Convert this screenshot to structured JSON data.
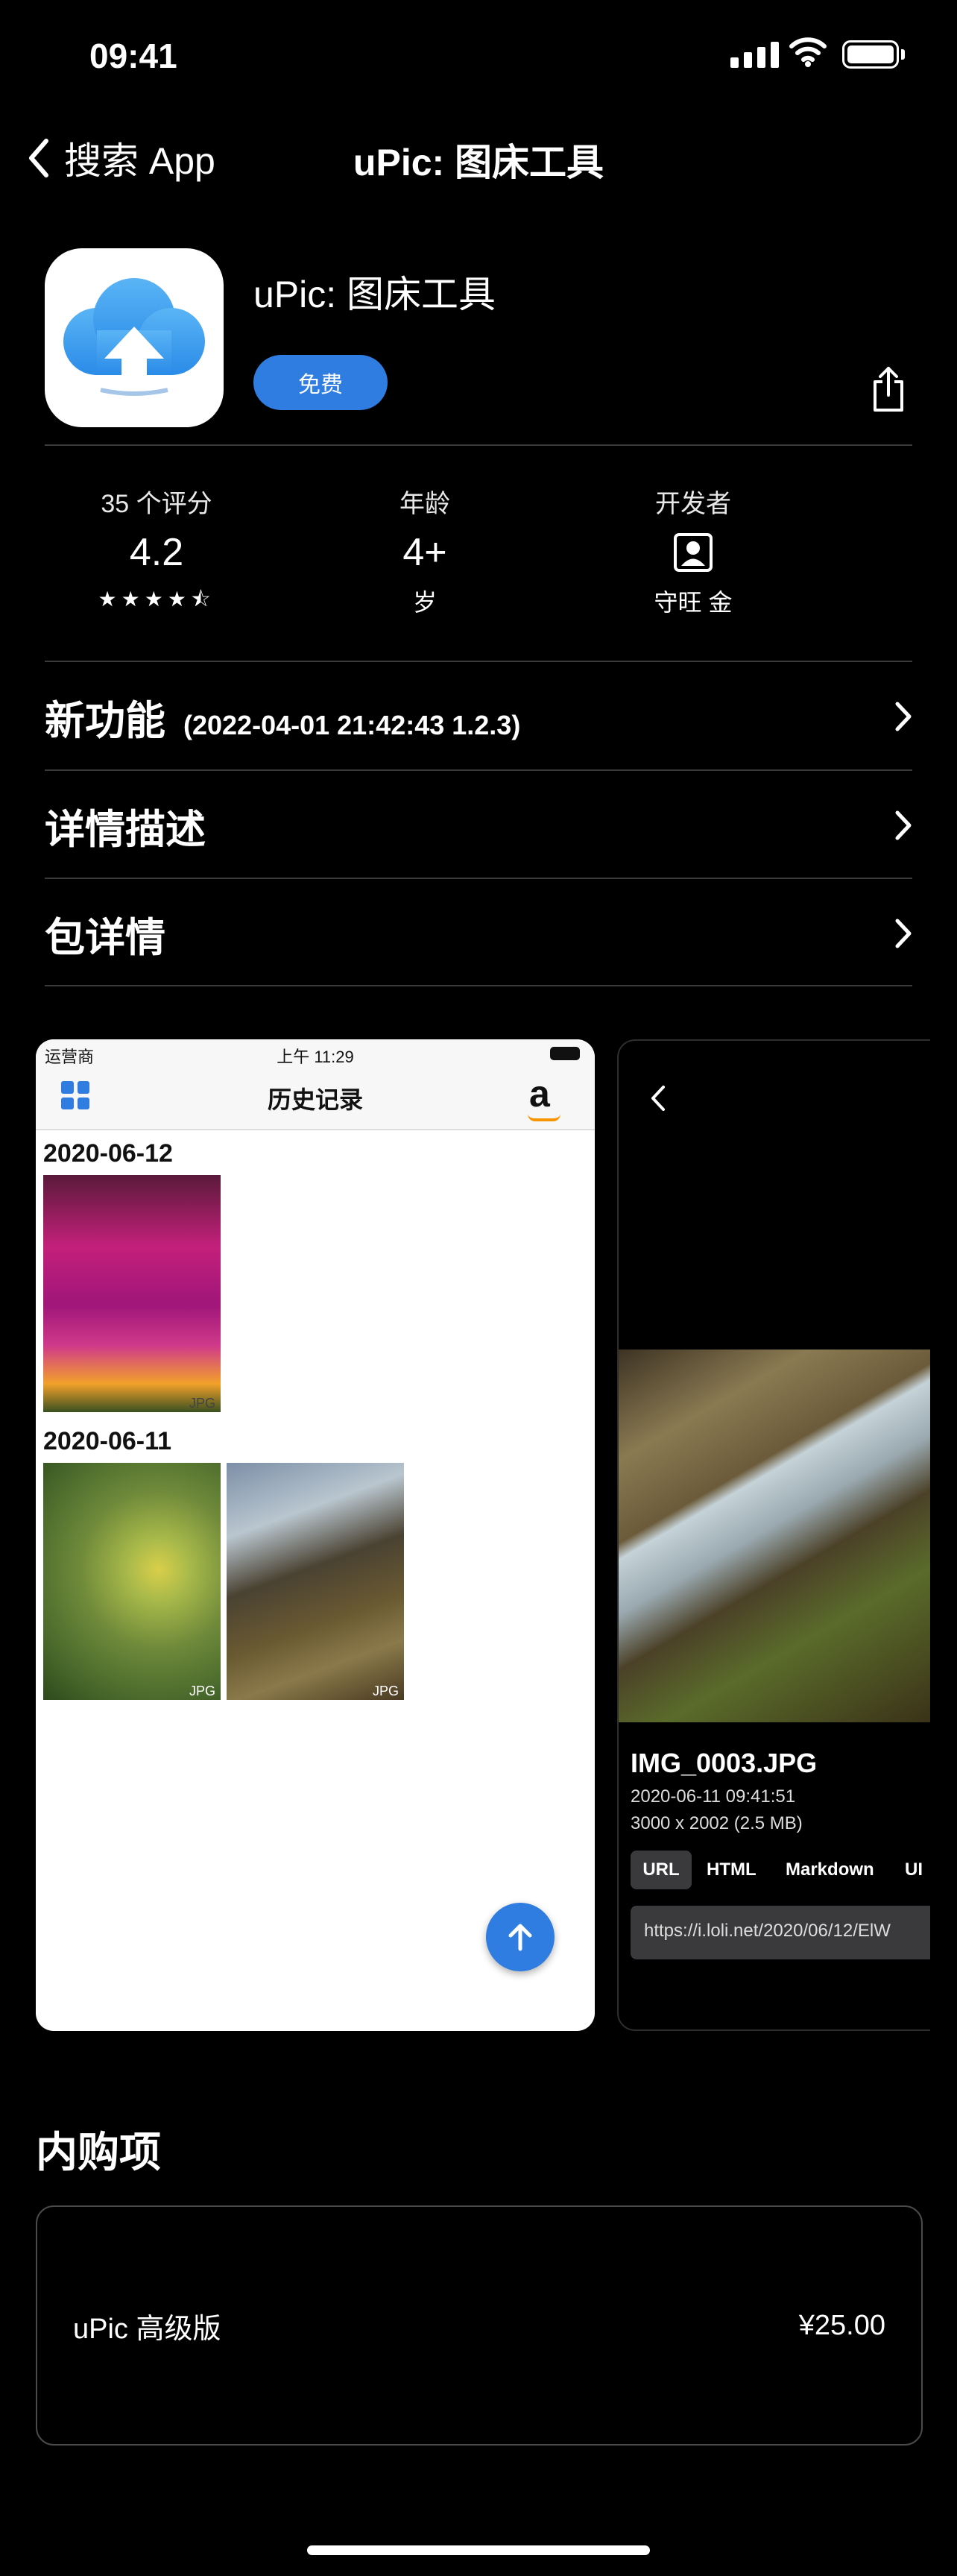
{
  "status_bar": {
    "time": "09:41"
  },
  "nav": {
    "back_label": "搜索 App",
    "title": "uPic: 图床工具"
  },
  "app": {
    "name": "uPic: 图床工具",
    "get_label": "免费"
  },
  "stats": {
    "ratings": {
      "label": "35 个评分",
      "value": "4.2",
      "stars": "★★★★⯪"
    },
    "age": {
      "label": "年龄",
      "value": "4+",
      "unit": "岁"
    },
    "developer": {
      "label": "开发者",
      "name": "守旺 金"
    }
  },
  "rows": {
    "whats_new": {
      "title": "新功能",
      "meta": "(2022-04-01 21:42:43  1.2.3)"
    },
    "description": {
      "title": "详情描述"
    },
    "package": {
      "title": "包详情"
    }
  },
  "screenshot1": {
    "carrier": "运营商",
    "time": "上午 11:29",
    "title": "历史记录",
    "amazon": "a",
    "groups": [
      {
        "date": "2020-06-12",
        "tags": [
          "JPG"
        ]
      },
      {
        "date": "2020-06-11",
        "tags": [
          "JPG",
          "JPG"
        ]
      }
    ]
  },
  "screenshot2": {
    "filename": "IMG_0003.JPG",
    "datetime": "2020-06-11 09:41:51",
    "size": "3000 x 2002 (2.5 MB)",
    "tabs": [
      "URL",
      "HTML",
      "Markdown",
      "UI"
    ],
    "url": "https://i.loli.net/2020/06/12/ElW"
  },
  "iap": {
    "title": "内购项",
    "item_name": "uPic 高级版",
    "item_price": "¥25.00"
  }
}
